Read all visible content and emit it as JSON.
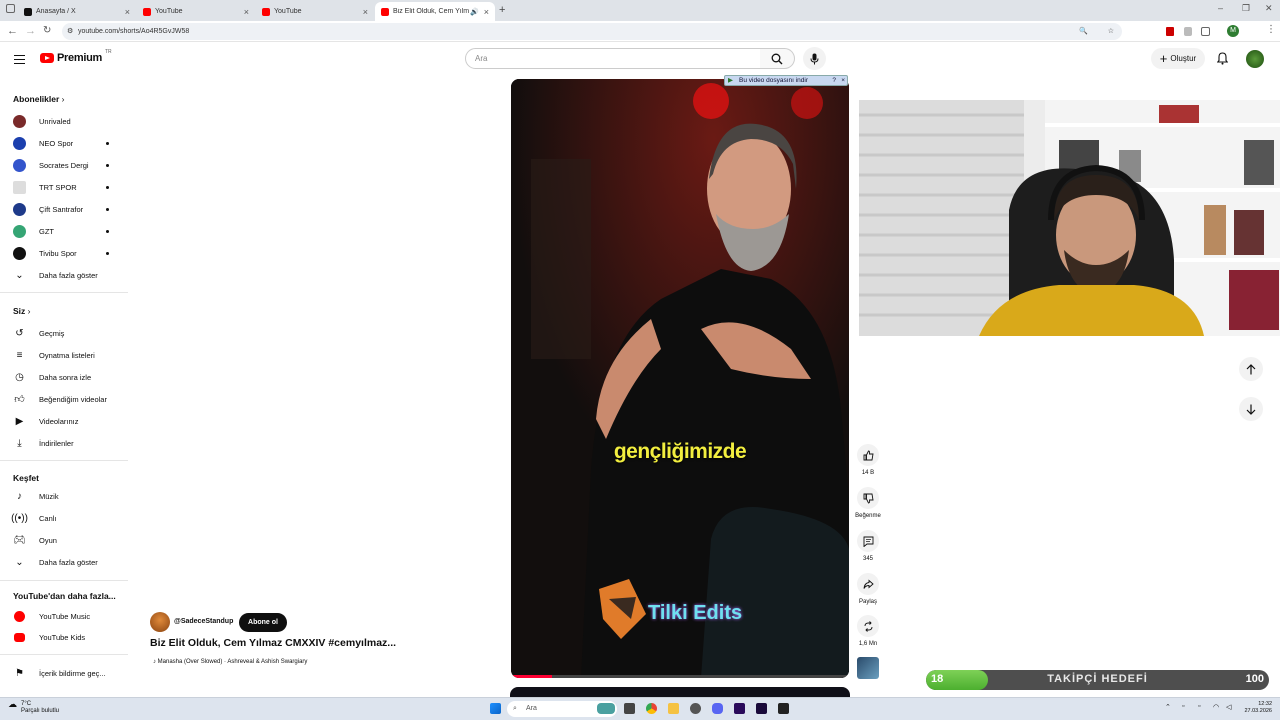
{
  "browser": {
    "tabs": [
      {
        "label": "Anasayfa / X",
        "icon": "x-icon"
      },
      {
        "label": "YouTube",
        "icon": "youtube-icon"
      },
      {
        "label": "YouTube",
        "icon": "youtube-icon"
      },
      {
        "label": "Biz Elit Olduk, Cem Yılmaz",
        "icon": "youtube-icon",
        "active": true
      }
    ],
    "url": "youtube.com/shorts/Ao4R5GvJW58",
    "profile_initial": "M"
  },
  "header": {
    "logo_text": "Premium",
    "logo_region": "TR",
    "search_placeholder": "Ara",
    "create_label": "Oluştur"
  },
  "sidebar": {
    "subscriptions_title": "Abonelikler",
    "subscriptions": [
      {
        "label": "Unrivaled",
        "color": "#7a2a2a",
        "dot": false
      },
      {
        "label": "NEO Spor",
        "color": "#1b3fae",
        "dot": true
      },
      {
        "label": "Socrates Dergi",
        "color": "#3355cc",
        "dot": true
      },
      {
        "label": "TRT SPOR",
        "color": "#dddddd",
        "dot": true
      },
      {
        "label": "Çift Santrafor",
        "color": "#1e3a8a",
        "dot": true
      },
      {
        "label": "GZT",
        "color": "#35a574",
        "dot": true
      },
      {
        "label": "Tivibu Spor",
        "color": "#111111",
        "dot": true
      }
    ],
    "show_more": "Daha fazla göster",
    "you_title": "Siz",
    "you_items": [
      {
        "label": "Geçmiş",
        "icon": "history-icon"
      },
      {
        "label": "Oynatma listeleri",
        "icon": "playlist-icon"
      },
      {
        "label": "Daha sonra izle",
        "icon": "watch-later-icon"
      },
      {
        "label": "Beğendiğim videolar",
        "icon": "like-icon"
      },
      {
        "label": "Videolarınız",
        "icon": "your-videos-icon"
      },
      {
        "label": "İndirilenler",
        "icon": "download-icon"
      }
    ],
    "explore_title": "Keşfet",
    "explore_items": [
      {
        "label": "Müzik",
        "icon": "music-icon"
      },
      {
        "label": "Canlı",
        "icon": "live-icon"
      },
      {
        "label": "Oyun",
        "icon": "gaming-icon"
      },
      {
        "label": "Daha fazla göster",
        "icon": "chevron-down-icon"
      }
    ],
    "more_title": "YouTube'dan daha fazla...",
    "more_items": [
      {
        "label": "YouTube Music",
        "icon": "youtube-music-icon"
      },
      {
        "label": "YouTube Kids",
        "icon": "youtube-kids-icon"
      }
    ],
    "report_history": "İçerik bildirme geç..."
  },
  "video": {
    "caption": "gençliğimizde",
    "watermark": "Tilki Edits",
    "download_bar": "Bu video dosyasını indir",
    "progress": 0.12,
    "channel": "@SadeceStandup",
    "subscribe_label": "Abone ol",
    "title": "Biz Elit Olduk, Cem Yılmaz CMXXIV #cemyılmaz...",
    "music": "Manasha (Over Slowed) · Ashreveal & Ashish Swargiary"
  },
  "actions": {
    "likes": "14 B",
    "dislike_label": "Beğenme",
    "comments": "345",
    "share_label": "Paylaş",
    "remix_count": "1,6 Mn"
  },
  "goal": {
    "current": "18",
    "title": "TAKİPÇİ HEDEFİ",
    "max": "100",
    "progress": 0.18
  },
  "taskbar": {
    "temperature": "7°C",
    "weather": "Parçalı bulutlu",
    "search_placeholder": "Ara",
    "time": "12:32",
    "date": "27.03.2026"
  }
}
